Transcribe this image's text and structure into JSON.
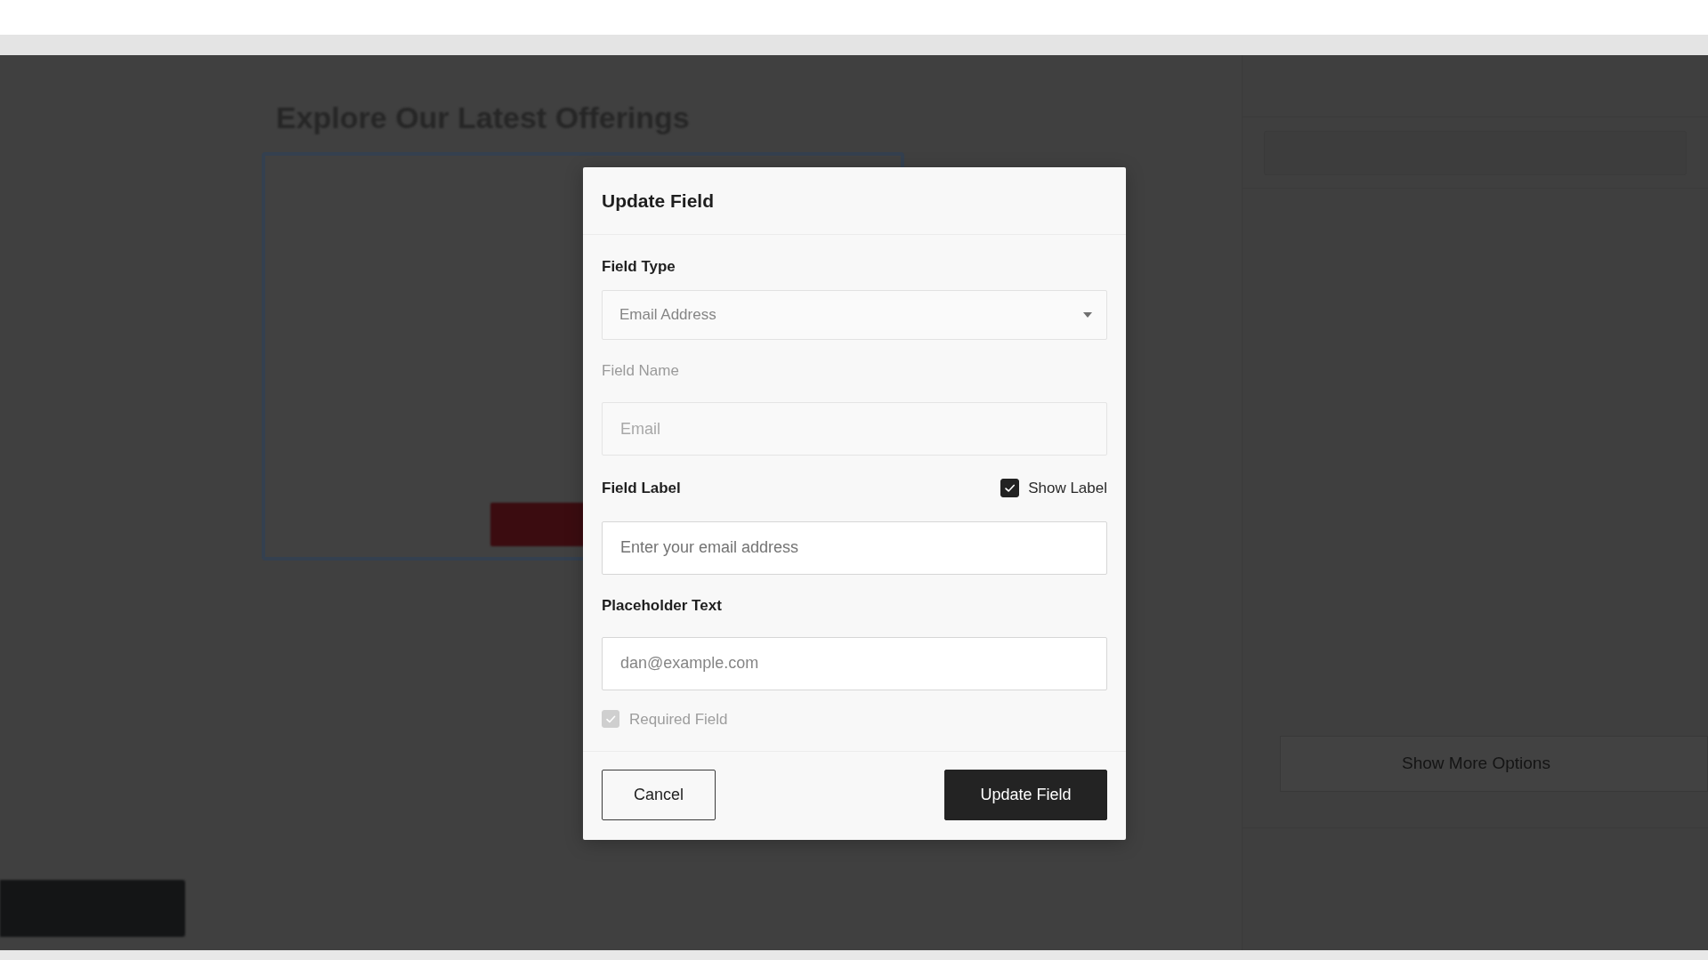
{
  "background": {
    "heading": "Explore Our Latest Offerings",
    "side_panel": {
      "button": "Show More Options"
    }
  },
  "dialog": {
    "title": "Update Field",
    "fields": [
      {
        "kind": "select",
        "label": "Field Type",
        "value": "Email Address",
        "disabled": false
      },
      {
        "kind": "text",
        "label": "Field Name",
        "placeholder": "Email",
        "disabled": true
      },
      {
        "kind": "text",
        "label": "Field Label",
        "value": "Enter your email address",
        "disabled": false,
        "toggle": {
          "label": "Show Label",
          "checked": true
        }
      },
      {
        "kind": "text",
        "label": "Placeholder Text",
        "placeholder": "dan@example.com",
        "disabled": false
      }
    ],
    "required": {
      "label": "Required Field",
      "checked": true,
      "disabled": true
    },
    "buttons": [
      {
        "label": "Cancel",
        "kind": "secondary"
      },
      {
        "label": "Update Field",
        "kind": "primary"
      }
    ]
  }
}
